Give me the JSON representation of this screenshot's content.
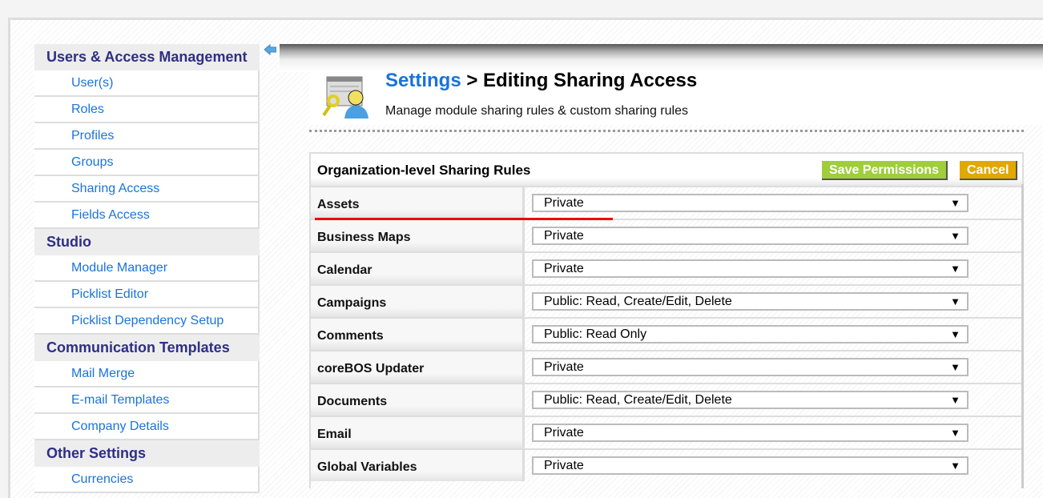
{
  "sidebar": {
    "sections": [
      {
        "title": "Users & Access Management",
        "items": [
          "User(s)",
          "Roles",
          "Profiles",
          "Groups",
          "Sharing Access",
          "Fields Access"
        ]
      },
      {
        "title": "Studio",
        "items": [
          "Module Manager",
          "Picklist Editor",
          "Picklist Dependency Setup"
        ]
      },
      {
        "title": "Communication Templates",
        "items": [
          "Mail Merge",
          "E-mail Templates",
          "Company Details"
        ]
      },
      {
        "title": "Other Settings",
        "items": [
          "Currencies"
        ]
      }
    ]
  },
  "header": {
    "breadcrumb_link": "Settings",
    "title": "> Editing Sharing Access",
    "subtitle": "Manage module sharing rules & custom sharing rules"
  },
  "table": {
    "title": "Organization-level Sharing Rules",
    "save_label": "Save Permissions",
    "cancel_label": "Cancel",
    "rows": [
      {
        "module": "Assets",
        "value": "Private"
      },
      {
        "module": "Business Maps",
        "value": "Private"
      },
      {
        "module": "Calendar",
        "value": "Private"
      },
      {
        "module": "Campaigns",
        "value": "Public: Read, Create/Edit, Delete"
      },
      {
        "module": "Comments",
        "value": "Public: Read Only"
      },
      {
        "module": "coreBOS Updater",
        "value": "Private"
      },
      {
        "module": "Documents",
        "value": "Public: Read, Create/Edit, Delete"
      },
      {
        "module": "Email",
        "value": "Private"
      },
      {
        "module": "Global Variables",
        "value": "Private"
      }
    ]
  },
  "colors": {
    "link": "#1a73d9",
    "section": "#2e2e86",
    "save": "#9fcd3c",
    "cancel": "#e0a800",
    "highlight": "#e00000"
  }
}
